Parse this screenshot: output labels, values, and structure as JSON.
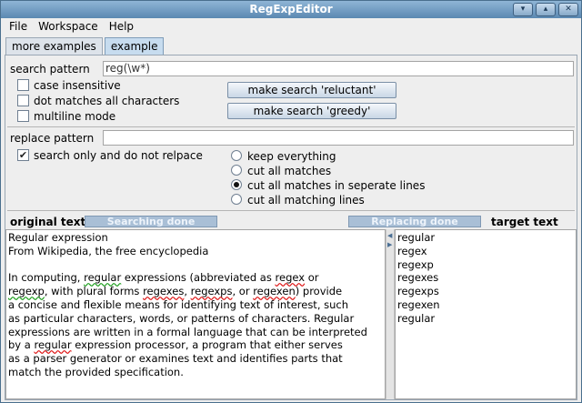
{
  "window": {
    "title": "RegExpEditor",
    "controls": {
      "minimize": "▾",
      "maximize": "▴",
      "close": "✕"
    }
  },
  "menu": [
    "File",
    "Workspace",
    "Help"
  ],
  "tabs": [
    {
      "label": "more examples",
      "active": false
    },
    {
      "label": "example",
      "active": true
    }
  ],
  "search": {
    "label": "search pattern",
    "value": "reg(\\w*)",
    "options": [
      {
        "label": "case insensitive",
        "checked": false
      },
      {
        "label": "dot matches all characters",
        "checked": false
      },
      {
        "label": "multiline mode",
        "checked": false
      }
    ],
    "reluctant_button": "make search 'reluctant'",
    "greedy_button": "make search 'greedy'"
  },
  "replace": {
    "label": "replace pattern",
    "value": "",
    "search_only": {
      "label": "search only and do not relpace",
      "checked": true,
      "glyph": "✔"
    },
    "modes": [
      {
        "label": "keep everything",
        "selected": false
      },
      {
        "label": "cut all matches",
        "selected": false
      },
      {
        "label": "cut all matches in seperate lines",
        "selected": true
      },
      {
        "label": "cut all matching lines",
        "selected": false
      }
    ]
  },
  "status": {
    "original_label": "original text",
    "searching": "Searching done",
    "replacing": "Replacing done",
    "target_label": "target text"
  },
  "original_text": {
    "lines": [
      [
        {
          "t": "Regular expression"
        }
      ],
      [
        {
          "t": "From Wikipedia, the free encyclopedia"
        }
      ],
      [
        {
          "t": ""
        }
      ],
      [
        {
          "t": "In computing, "
        },
        {
          "t": "regular",
          "s": "green"
        },
        {
          "t": " expressions (abbreviated as "
        },
        {
          "t": "regex",
          "s": "red"
        },
        {
          "t": " or"
        }
      ],
      [
        {
          "t": "regexp",
          "s": "green"
        },
        {
          "t": ", with plural forms "
        },
        {
          "t": "regexes",
          "s": "red"
        },
        {
          "t": ", "
        },
        {
          "t": "regexps",
          "s": "red"
        },
        {
          "t": ", or "
        },
        {
          "t": "regexen",
          "s": "red"
        },
        {
          "t": ") provide"
        }
      ],
      [
        {
          "t": "a concise and flexible means for identifying text of interest, such"
        }
      ],
      [
        {
          "t": "as particular characters, words, or patterns of characters. Regular"
        }
      ],
      [
        {
          "t": "expressions are written in a formal language that can be interpreted"
        }
      ],
      [
        {
          "t": "by a "
        },
        {
          "t": "regular",
          "s": "red"
        },
        {
          "t": " expression processor, a program that either serves"
        }
      ],
      [
        {
          "t": "as a parser generator or examines text and identifies parts that"
        }
      ],
      [
        {
          "t": "match the provided specification."
        }
      ]
    ]
  },
  "target_text": {
    "lines": [
      "regular",
      "regex",
      "regexp",
      "regexes",
      "regexps",
      "regexen",
      "regular"
    ]
  }
}
